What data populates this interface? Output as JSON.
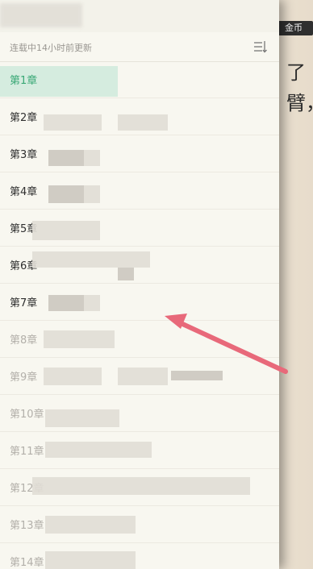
{
  "background_page": {
    "coin_badge": "金币",
    "text_line_1": "了",
    "text_line_2": "臂，"
  },
  "toc": {
    "status": "连载中14小时前更新",
    "sort_icon": "sort-icon",
    "chapters": [
      {
        "label": "第1章"
      },
      {
        "label": "第2章"
      },
      {
        "label": "第3章"
      },
      {
        "label": "第4章"
      },
      {
        "label": "第5章"
      },
      {
        "label": "第6章"
      },
      {
        "label": "第7章"
      },
      {
        "label": "第8章"
      },
      {
        "label": "第9章"
      },
      {
        "label": "第10章"
      },
      {
        "label": "第11章"
      },
      {
        "label": "第12章"
      },
      {
        "label": "第13章"
      },
      {
        "label": "第14章"
      }
    ],
    "active_index": 0
  },
  "colors": {
    "active_chapter": "#3aa876",
    "annotation_arrow": "#e8697a"
  }
}
